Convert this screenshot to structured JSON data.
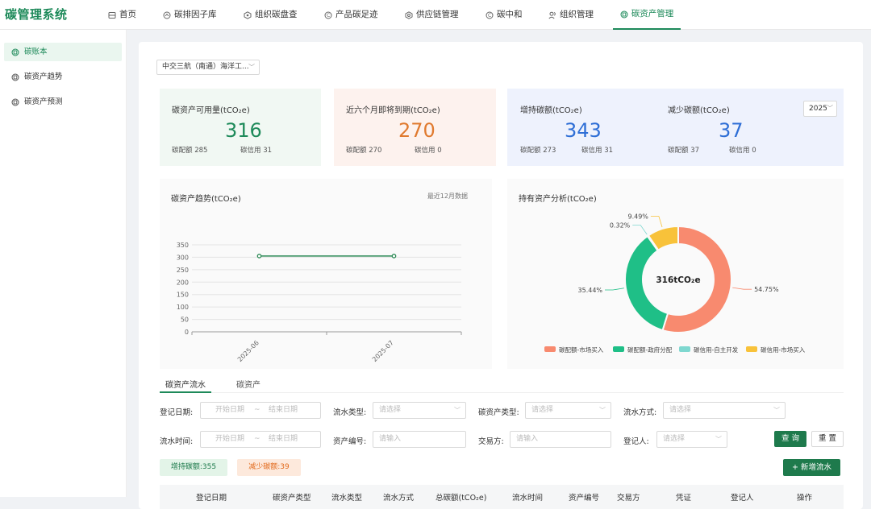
{
  "app": {
    "title": "碳管理系统"
  },
  "nav": [
    {
      "label": "首页",
      "icon": "home-icon"
    },
    {
      "label": "碳排因子库",
      "icon": "factor-icon"
    },
    {
      "label": "组织碳盘查",
      "icon": "inventory-icon"
    },
    {
      "label": "产品碳足迹",
      "icon": "footprint-icon"
    },
    {
      "label": "供应链管理",
      "icon": "supply-chain-icon"
    },
    {
      "label": "碳中和",
      "icon": "neutral-icon"
    },
    {
      "label": "组织管理",
      "icon": "users-icon"
    },
    {
      "label": "碳资产管理",
      "icon": "asset-icon",
      "active": true
    }
  ],
  "sidebar": {
    "items": [
      {
        "label": "碳账本",
        "active": true
      },
      {
        "label": "碳资产趋势"
      },
      {
        "label": "碳资产预测"
      }
    ]
  },
  "org_select": {
    "value": "中交三航（南通）海洋工..."
  },
  "cards": {
    "available": {
      "title": "碳资产可用量(tCO₂e)",
      "value": "316",
      "quota": "碳配额 285",
      "credit": "碳信用 31"
    },
    "expiring": {
      "title": "近六个月即将到期(tCO₂e)",
      "value": "270",
      "quota": "碳配额 270",
      "credit": "碳信用 0"
    },
    "increase": {
      "title": "增持碳额(tCO₂e)",
      "value": "343",
      "quota": "碳配额 273",
      "credit": "碳信用 31"
    },
    "decrease": {
      "title": "减少碳额(tCO₂e)",
      "value": "37",
      "quota": "碳配额 37",
      "credit": "碳信用 0"
    },
    "year": "2025"
  },
  "trend_panel": {
    "title": "碳资产趋势(tCO₂e)",
    "note": "最近12月数据"
  },
  "holdings_panel": {
    "title": "持有资产分析(tCO₂e)",
    "center_label": "316tCO₂e"
  },
  "chart_data": [
    {
      "type": "line",
      "title": "碳资产趋势(tCO₂e)",
      "x": [
        "2025-06",
        "2025-07"
      ],
      "series": [
        {
          "values": [
            305,
            305
          ]
        }
      ],
      "ylim": [
        0,
        350
      ],
      "yticks": [
        0,
        50,
        100,
        150,
        200,
        250,
        300,
        350
      ],
      "grid": true,
      "color": "#2e8b57"
    },
    {
      "type": "pie",
      "title": "持有资产分析(tCO₂e)",
      "categories": [
        "碳配额-市场买入",
        "碳配额-政府分配",
        "碳信用-自主开发",
        "碳信用-市场买入"
      ],
      "values": [
        54.75,
        35.44,
        0.32,
        9.49
      ],
      "labels": [
        "54.75%",
        "35.44%",
        "0.32%",
        "9.49%"
      ],
      "colors": [
        "#f88a6f",
        "#1fbf87",
        "#7fd8d0",
        "#f8c23a"
      ],
      "legend": "bottom"
    }
  ],
  "tabs": [
    {
      "label": "碳资产流水",
      "active": true
    },
    {
      "label": "碳资产"
    }
  ],
  "filters": {
    "reg_date_label": "登记日期:",
    "flow_time_label": "流水时间:",
    "start_placeholder": "开始日期",
    "end_placeholder": "结束日期",
    "range_sep": "~",
    "flow_type_label": "流水类型:",
    "asset_type_label": "碳资产类型:",
    "flow_method_label": "流水方式:",
    "asset_no_label": "资产编号:",
    "counterparty_label": "交易方:",
    "registrant_label": "登记人:",
    "select_placeholder": "请选择",
    "input_placeholder": "请输入",
    "query_label": "查 询",
    "reset_label": "重 置"
  },
  "summary": {
    "increase": "增持碳额:355",
    "decrease": "减少碳额:39"
  },
  "add_button": "+ 新增流水",
  "table": {
    "columns": [
      "登记日期",
      "碳资产类型",
      "流水类型",
      "流水方式",
      "总碳额(tCO₂e)",
      "流水时间",
      "资产编号",
      "交易方",
      "凭证",
      "登记人",
      "操作"
    ]
  }
}
